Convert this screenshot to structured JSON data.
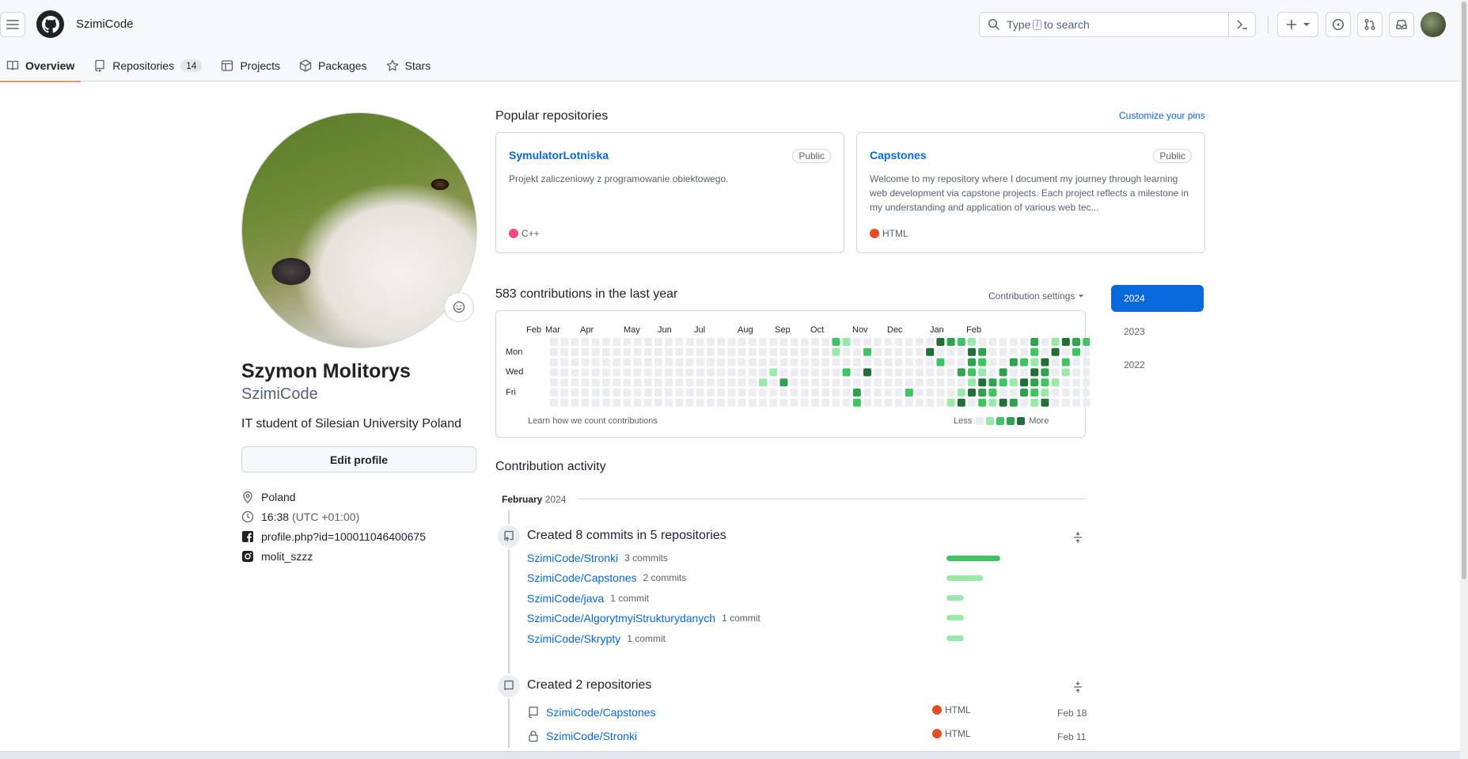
{
  "header": {
    "username": "SzimiCode",
    "search_prefix": "Type",
    "search_key": "/",
    "search_suffix": "to search"
  },
  "tabs": [
    {
      "label": "Overview",
      "active": true
    },
    {
      "label": "Repositories",
      "count": "14"
    },
    {
      "label": "Projects"
    },
    {
      "label": "Packages"
    },
    {
      "label": "Stars"
    }
  ],
  "profile": {
    "full_name": "Szymon Molitorys",
    "login": "SzimiCode",
    "bio": "IT student of Silesian University Poland",
    "edit_label": "Edit profile",
    "location": "Poland",
    "time": "16:38",
    "timezone": "(UTC +01:00)",
    "facebook": "profile.php?id=100011046400675",
    "instagram": "molit_szzz"
  },
  "popular": {
    "title": "Popular repositories",
    "customize": "Customize your pins",
    "pins": [
      {
        "name": "SymulatorLotniska",
        "badge": "Public",
        "desc": "Projekt zaliczeniowy z programowanie obiektowego.",
        "lang": "C++",
        "lang_color": "#f34b7d"
      },
      {
        "name": "Capstones",
        "badge": "Public",
        "desc": "Welcome to my repository where I document my journey through learning web development via capstone projects. Each project reflects a milestone in my understanding and application of various web tec...",
        "lang": "HTML",
        "lang_color": "#e34c26"
      }
    ]
  },
  "contrib": {
    "title": "583 contributions in the last year",
    "settings": "Contribution settings",
    "months": [
      "Feb",
      "Mar",
      "Apr",
      "May",
      "Jun",
      "Jul",
      "Aug",
      "Sep",
      "Oct",
      "Nov",
      "Dec",
      "Jan",
      "Feb"
    ],
    "days": [
      "Mon",
      "Wed",
      "Fri"
    ],
    "learn": "Learn how we count contributions",
    "less": "Less",
    "more": "More",
    "level_colors": [
      "#ebedf0",
      "#9be9a8",
      "#40c463",
      "#30a14e",
      "#216e39"
    ]
  },
  "years": [
    "2024",
    "2023",
    "2022"
  ],
  "activity": {
    "title": "Contribution activity",
    "month": "February",
    "year": "2024",
    "commits_title": "Created 8 commits in 5 repositories",
    "commits": [
      {
        "repo": "SzimiCode/Stronki",
        "count": "3 commits",
        "ratio": 1.0
      },
      {
        "repo": "SzimiCode/Capstones",
        "count": "2 commits",
        "ratio": 0.67
      },
      {
        "repo": "SzimiCode/java",
        "count": "1 commit",
        "ratio": 0.33
      },
      {
        "repo": "SzimiCode/AlgorytmyiStrukturydanych",
        "count": "1 commit",
        "ratio": 0.33
      },
      {
        "repo": "SzimiCode/Skrypty",
        "count": "1 commit",
        "ratio": 0.33
      }
    ],
    "repos_title": "Created 2 repositories",
    "repos": [
      {
        "repo": "SzimiCode/Capstones",
        "lang": "HTML",
        "date": "Feb 18",
        "private": false
      },
      {
        "repo": "SzimiCode/Stronki",
        "lang": "HTML",
        "date": "Feb 11",
        "private": true
      }
    ],
    "html_color": "#e34c26",
    "bar_color_strong": "#40c463",
    "bar_color_light": "#9be9a8"
  }
}
